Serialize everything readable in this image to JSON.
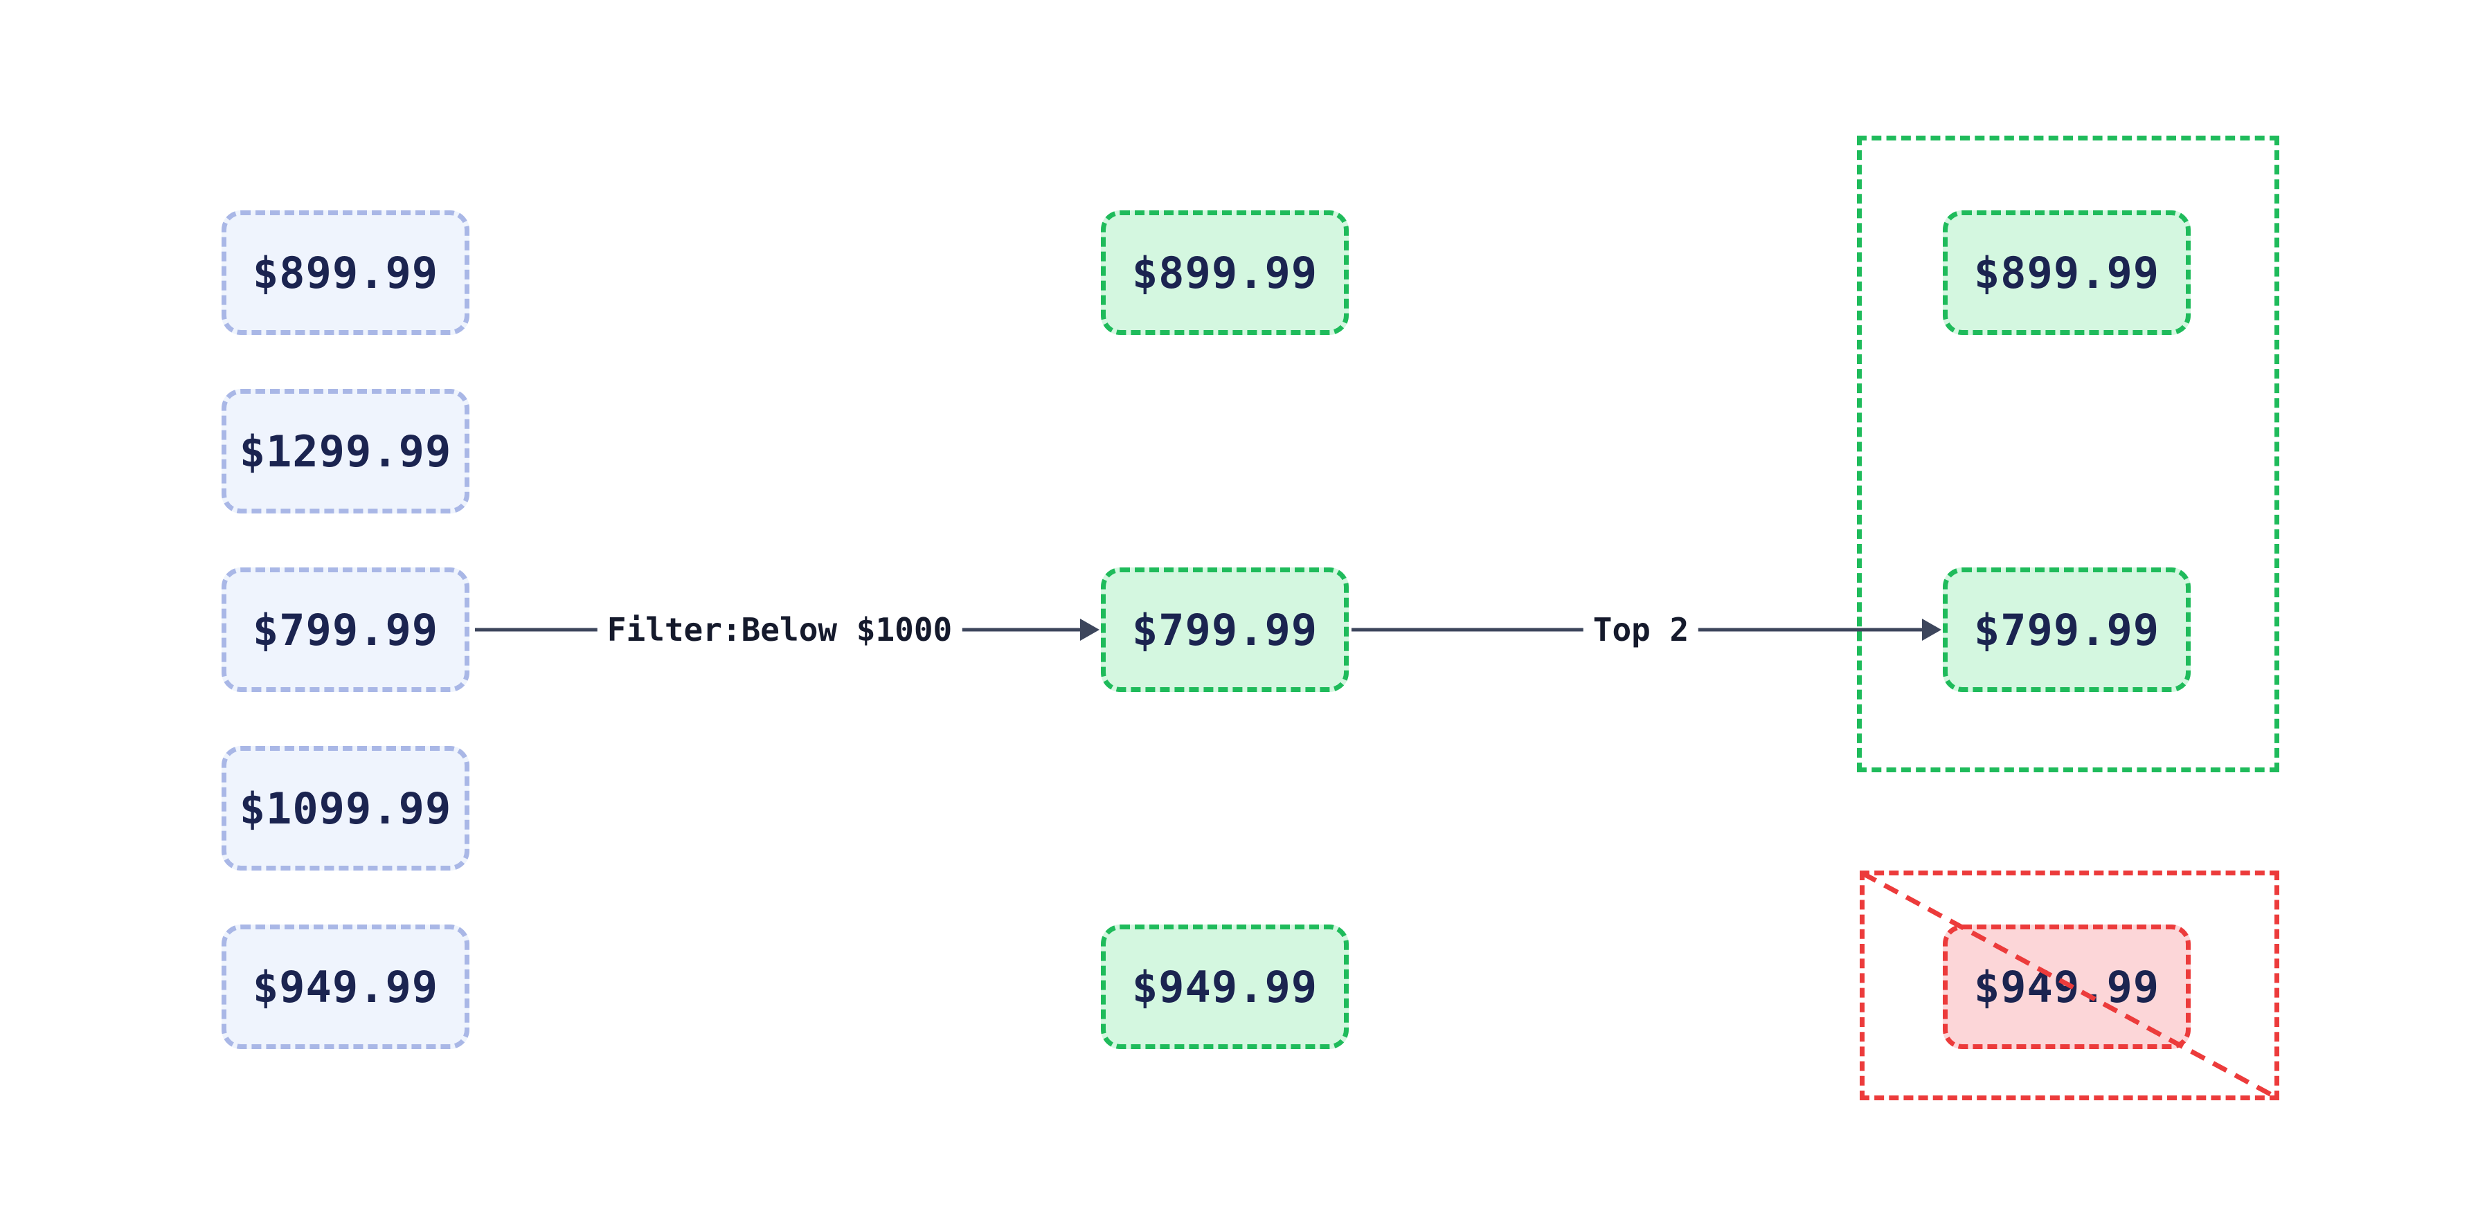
{
  "diagram": {
    "input_column": {
      "items": [
        {
          "price": "$899.99"
        },
        {
          "price": "$1299.99"
        },
        {
          "price": "$799.99"
        },
        {
          "price": "$1099.99"
        },
        {
          "price": "$949.99"
        }
      ]
    },
    "filtered_column": {
      "items": [
        {
          "price": "$899.99"
        },
        {
          "price": "$799.99"
        },
        {
          "price": "$949.99"
        }
      ]
    },
    "result_column": {
      "kept": [
        {
          "price": "$899.99"
        },
        {
          "price": "$799.99"
        }
      ],
      "dropped": [
        {
          "price": "$949.99"
        }
      ]
    },
    "edges": {
      "filter_label": "Filter:Below $1000",
      "limit_label": "Top 2"
    },
    "colors": {
      "input_border": "#a9b7e6",
      "input_fill": "#eff4fd",
      "kept_border": "#1fbb5b",
      "kept_fill": "#d4f7e0",
      "dropped_border": "#ec3b3b",
      "dropped_fill": "#fcd6d8",
      "arrow": "#3d465c",
      "text": "#1b2450"
    }
  }
}
